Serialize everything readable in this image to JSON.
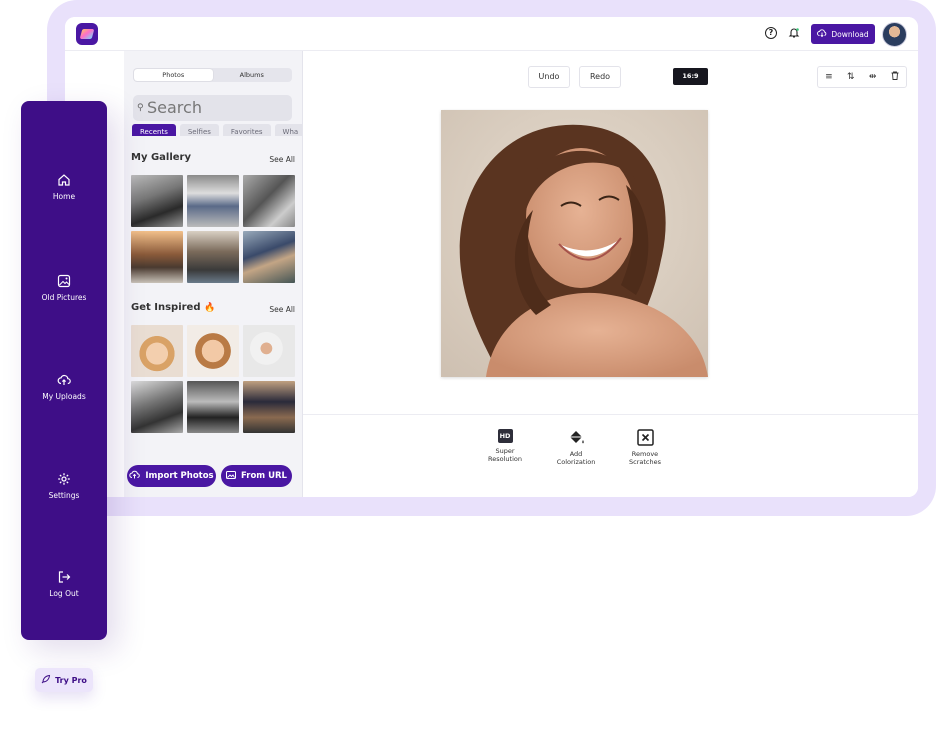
{
  "window": {
    "download_label": "Download"
  },
  "panel": {
    "tabs": [
      "Photos",
      "Albums"
    ],
    "search_placeholder": "Search",
    "filter_chips": [
      "Recents",
      "Selfies",
      "Favorites",
      "Wha"
    ],
    "gallery_title": "My Gallery",
    "inspired_title": "Get Inspired",
    "inspired_emoji": "🔥",
    "see_all": "See All",
    "import_label": "Import Photos",
    "url_label": "From URL"
  },
  "editor": {
    "undo_label": "Undo",
    "redo_label": "Redo",
    "ratio_label": "16:9",
    "actions": [
      {
        "icon": "hd-icon",
        "line1": "Super",
        "line2": "Resolution"
      },
      {
        "icon": "paint-bucket-icon",
        "line1": "Add",
        "line2": "Colorization"
      },
      {
        "icon": "x-box-icon",
        "line1": "Remove",
        "line2": "Scratches"
      }
    ]
  },
  "sidebar": {
    "items": [
      {
        "label": "Home",
        "icon": "home-icon"
      },
      {
        "label": "Old Pictures",
        "icon": "picture-icon"
      },
      {
        "label": "My Uploads",
        "icon": "cloud-upload-icon"
      },
      {
        "label": "Settings",
        "icon": "gear-icon"
      },
      {
        "label": "Log Out",
        "icon": "logout-icon"
      }
    ],
    "try_pro": "Try Pro"
  },
  "colors": {
    "brand": "#4a17a3",
    "sidebar": "#3e0e87",
    "frame": "#e9e1fb"
  }
}
